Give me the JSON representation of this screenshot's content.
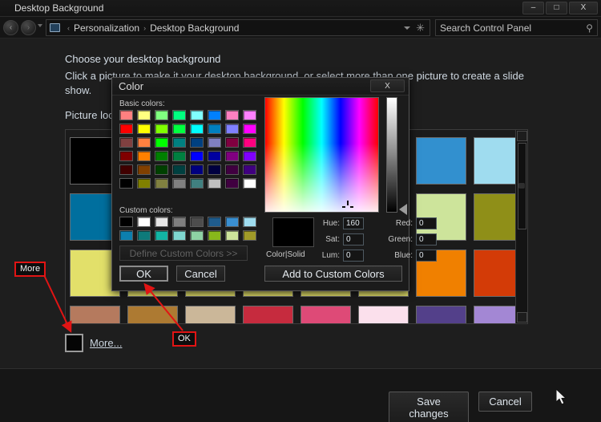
{
  "window": {
    "title": "Desktop Background",
    "minimize_label": "–",
    "maximize_label": "□",
    "close_label": "X"
  },
  "nav": {
    "back_label": "‹",
    "forward_label": "›",
    "computer_icon": "monitor-icon",
    "breadcrumb": [
      {
        "label": "Personalization",
        "sep": "‹"
      },
      {
        "label": "Desktop Background",
        "sep": "›"
      }
    ],
    "crumb1": "Personalization",
    "crumb2": "Desktop Background",
    "sep_left": "‹",
    "sep_right": "›",
    "refresh_glyph": "✳",
    "search_placeholder": "Search Control Panel",
    "search_icon": "⚲"
  },
  "main": {
    "heading": "Choose your desktop background",
    "subtext": "Click a picture to make it your desktop background, or select more than one picture to create a slide show.",
    "picture_location_label": "Picture loc",
    "more_link": "More...",
    "more_swatch_color": "#050505",
    "save_label": "Save changes",
    "cancel_label": "Cancel"
  },
  "gallery": {
    "thumbs": [
      "#000000",
      "#000000",
      "#000000",
      "#000000",
      "#000000",
      "#000000",
      "#3290cf",
      "#9fdcef",
      "#006f9e",
      "#006f9e",
      "#006f9e",
      "#006f9e",
      "#006f9e",
      "#006f9e",
      "#cde49b",
      "#8f8f18",
      "#e2e06a",
      "#e2e06a",
      "#e2e06a",
      "#e2e06a",
      "#e2e06a",
      "#e2e06a",
      "#f08000",
      "#d33b07",
      "#b57a5e",
      "#ad7a32",
      "#cbb799",
      "#c62b3e",
      "#de4a77",
      "#fbe0ec",
      "#53408a",
      "#a387d4"
    ]
  },
  "color_dialog": {
    "title": "Color",
    "close_label": "X",
    "basic_colors_label": "Basic colors:",
    "custom_colors_label": "Custom colors:",
    "basic_colors": [
      "#ff8080",
      "#ffff80",
      "#80ff80",
      "#00ff80",
      "#80ffff",
      "#0080ff",
      "#ff80c0",
      "#ff80ff",
      "#ff0000",
      "#ffff00",
      "#80ff00",
      "#00ff40",
      "#00ffff",
      "#0080c0",
      "#8080ff",
      "#ff00ff",
      "#804040",
      "#ff8040",
      "#00ff00",
      "#008080",
      "#004080",
      "#8080c0",
      "#800040",
      "#ff0080",
      "#800000",
      "#ff8000",
      "#008000",
      "#008040",
      "#0000ff",
      "#0000a0",
      "#800080",
      "#8000ff",
      "#400000",
      "#804000",
      "#004000",
      "#004040",
      "#000080",
      "#000040",
      "#400040",
      "#400080",
      "#000000",
      "#808000",
      "#808040",
      "#808080",
      "#408080",
      "#c0c0c0",
      "#400040",
      "#ffffff"
    ],
    "custom_colors": [
      "#000000",
      "#ffffff",
      "#e6e6e6",
      "#7f7f7f",
      "#4d4d4d",
      "#1f5c8c",
      "#3a8fd0",
      "#9fdcef",
      "#0d7fae",
      "#0e7a7a",
      "#12b4a4",
      "#7fd6d0",
      "#8ed2a4",
      "#88b81b",
      "#cde49b",
      "#a09a28"
    ],
    "spectrum_name": "color-spectrum",
    "lum_slider_name": "luminance-slider",
    "color_solid_label": "Color|Solid",
    "color_solid_value": "#000000",
    "fields": {
      "hue_label": "Hue:",
      "hue_value": "160",
      "sat_label": "Sat:",
      "sat_value": "0",
      "lum_label": "Lum:",
      "lum_value": "0",
      "red_label": "Red:",
      "red_value": "0",
      "green_label": "Green:",
      "green_value": "0",
      "blue_label": "Blue:",
      "blue_value": "0"
    },
    "define_label": "Define Custom Colors >>",
    "ok_label": "OK",
    "cancel_label": "Cancel",
    "add_label": "Add to Custom Colors"
  },
  "annotations": {
    "more": "More",
    "ok": "OK",
    "accent": "#e11414"
  }
}
